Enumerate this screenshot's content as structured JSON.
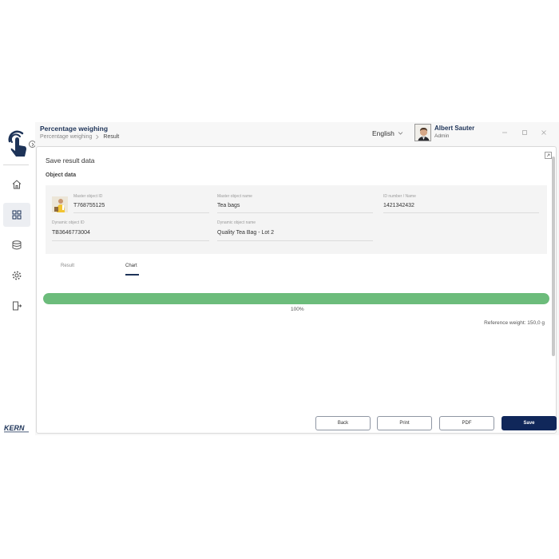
{
  "header": {
    "title": "Percentage weighing",
    "breadcrumb": [
      "Percentage weighing",
      "Result"
    ],
    "language": "English",
    "user": {
      "name": "Albert Sauter",
      "role": "Admin"
    }
  },
  "sidebar": {
    "items": [
      {
        "icon": "home-icon",
        "active": false
      },
      {
        "icon": "dashboard-grid-icon",
        "active": true
      },
      {
        "icon": "database-icon",
        "active": false
      },
      {
        "icon": "settings-gear-icon",
        "active": false
      },
      {
        "icon": "logout-icon",
        "active": false
      }
    ],
    "brand": "KERN"
  },
  "panel": {
    "title": "Save result data",
    "section_title": "Object data",
    "fields": {
      "master_object_id": {
        "label": "Master object ID",
        "value": "T768755125"
      },
      "master_object_name": {
        "label": "Master object name",
        "value": "Tea bags"
      },
      "id_number": {
        "label": "ID number / Name",
        "value": "1421342432"
      },
      "dynamic_object_id": {
        "label": "Dynamic object ID",
        "value": "TB3646773004"
      },
      "dynamic_object_name": {
        "label": "Dynamic object name",
        "value": "Quality Tea Bag - Lot 2"
      }
    },
    "tabs": [
      {
        "label": "Result",
        "active": false
      },
      {
        "label": "Chart",
        "active": true
      }
    ],
    "progress": {
      "value_percent": 100,
      "label": "100%",
      "color": "#6cbc7b"
    },
    "reference_weight": "Reference weight: 150,0 g"
  },
  "buttons": {
    "back": "Back",
    "print": "Print",
    "pdf": "PDF",
    "save": "Save"
  },
  "colors": {
    "brand_navy": "#10275a",
    "title_navy": "#1d3358",
    "progress_green": "#6cbc7b"
  }
}
